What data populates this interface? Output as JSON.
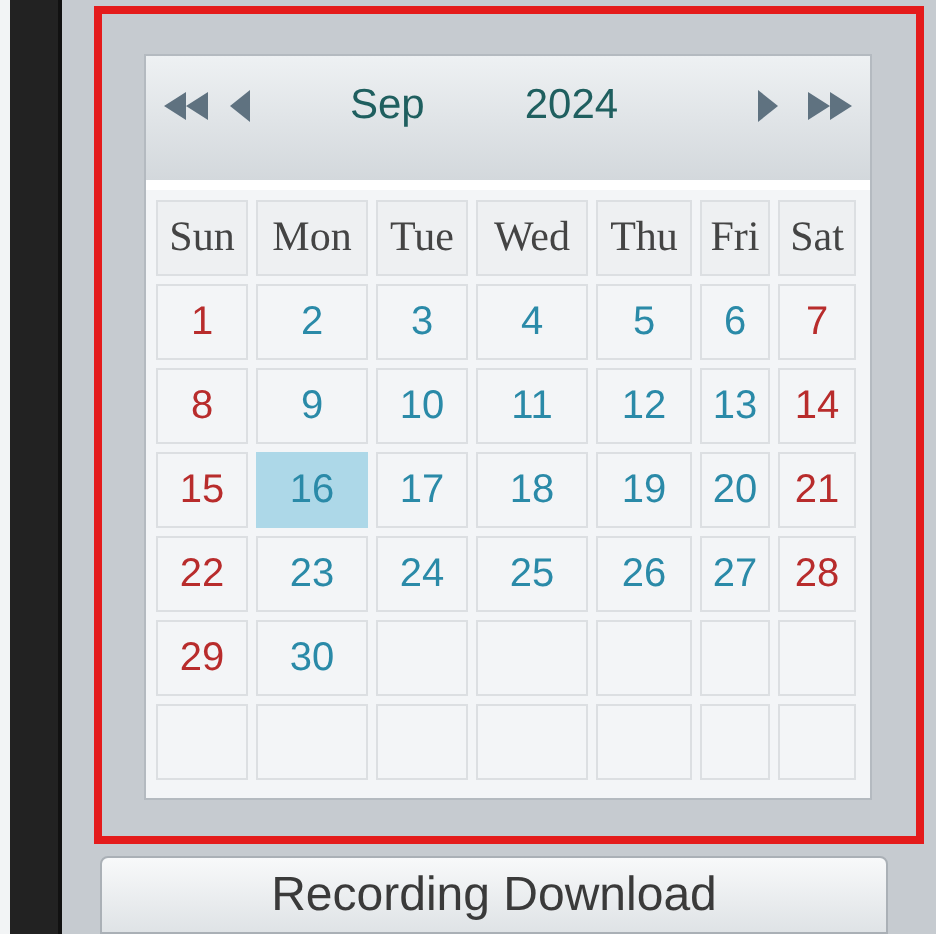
{
  "calendar": {
    "month": "Sep",
    "year": "2024",
    "weekdays": [
      "Sun",
      "Mon",
      "Tue",
      "Wed",
      "Thu",
      "Fri",
      "Sat"
    ],
    "weeks": [
      [
        {
          "day": "1",
          "weekend": true,
          "selected": false
        },
        {
          "day": "2",
          "weekend": false,
          "selected": false
        },
        {
          "day": "3",
          "weekend": false,
          "selected": false
        },
        {
          "day": "4",
          "weekend": false,
          "selected": false
        },
        {
          "day": "5",
          "weekend": false,
          "selected": false
        },
        {
          "day": "6",
          "weekend": false,
          "selected": false
        },
        {
          "day": "7",
          "weekend": true,
          "selected": false
        }
      ],
      [
        {
          "day": "8",
          "weekend": true,
          "selected": false
        },
        {
          "day": "9",
          "weekend": false,
          "selected": false
        },
        {
          "day": "10",
          "weekend": false,
          "selected": false
        },
        {
          "day": "11",
          "weekend": false,
          "selected": false
        },
        {
          "day": "12",
          "weekend": false,
          "selected": false
        },
        {
          "day": "13",
          "weekend": false,
          "selected": false
        },
        {
          "day": "14",
          "weekend": true,
          "selected": false
        }
      ],
      [
        {
          "day": "15",
          "weekend": true,
          "selected": false
        },
        {
          "day": "16",
          "weekend": false,
          "selected": true
        },
        {
          "day": "17",
          "weekend": false,
          "selected": false
        },
        {
          "day": "18",
          "weekend": false,
          "selected": false
        },
        {
          "day": "19",
          "weekend": false,
          "selected": false
        },
        {
          "day": "20",
          "weekend": false,
          "selected": false
        },
        {
          "day": "21",
          "weekend": true,
          "selected": false
        }
      ],
      [
        {
          "day": "22",
          "weekend": true,
          "selected": false
        },
        {
          "day": "23",
          "weekend": false,
          "selected": false
        },
        {
          "day": "24",
          "weekend": false,
          "selected": false
        },
        {
          "day": "25",
          "weekend": false,
          "selected": false
        },
        {
          "day": "26",
          "weekend": false,
          "selected": false
        },
        {
          "day": "27",
          "weekend": false,
          "selected": false
        },
        {
          "day": "28",
          "weekend": true,
          "selected": false
        }
      ],
      [
        {
          "day": "29",
          "weekend": true,
          "selected": false
        },
        {
          "day": "30",
          "weekend": false,
          "selected": false
        }
      ]
    ]
  },
  "download_button": "Recording Download"
}
